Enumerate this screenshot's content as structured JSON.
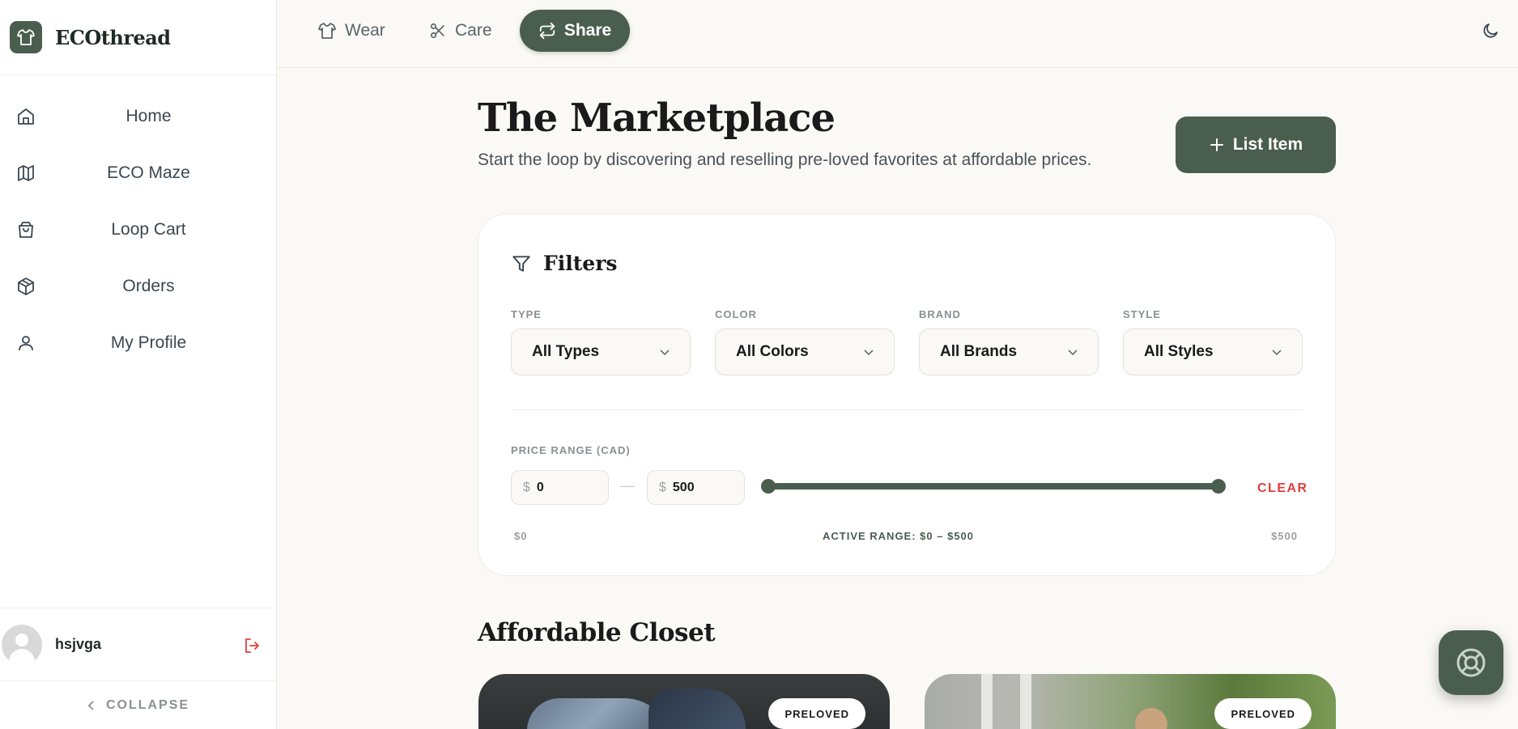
{
  "brand": {
    "name": "ECOthread",
    "logo_icon": "shirt-icon"
  },
  "sidebar": {
    "items": [
      {
        "label": "Home",
        "icon": "home-icon"
      },
      {
        "label": "ECO Maze",
        "icon": "map-icon"
      },
      {
        "label": "Loop Cart",
        "icon": "shopping-bag-icon"
      },
      {
        "label": "Orders",
        "icon": "package-icon"
      },
      {
        "label": "My Profile",
        "icon": "user-icon"
      }
    ],
    "user": {
      "name": "hsjvga"
    },
    "collapse_label": "COLLAPSE"
  },
  "topbar": {
    "tabs": [
      {
        "label": "Wear",
        "icon": "shirt-icon",
        "active": false
      },
      {
        "label": "Care",
        "icon": "scissors-icon",
        "active": false
      },
      {
        "label": "Share",
        "icon": "repeat-icon",
        "active": true
      }
    ],
    "theme_icon": "moon-icon"
  },
  "main": {
    "title": "The Marketplace",
    "subtitle": "Start the loop by discovering and reselling pre-loved favorites at affordable prices.",
    "list_button": "List Item",
    "filters": {
      "heading": "Filters",
      "type": {
        "label": "TYPE",
        "value": "All Types"
      },
      "color": {
        "label": "COLOR",
        "value": "All Colors"
      },
      "brand": {
        "label": "BRAND",
        "value": "All Brands"
      },
      "style": {
        "label": "STYLE",
        "value": "All Styles"
      },
      "price": {
        "label": "PRICE RANGE (CAD)",
        "currency": "$",
        "min_value": "0",
        "max_value": "500",
        "slider_low": 0,
        "slider_high": 500,
        "slider_max": 500,
        "clear_label": "CLEAR",
        "range_min_label": "$0",
        "range_active_label": "ACTIVE RANGE: $0 – $500",
        "range_max_label": "$500"
      }
    },
    "section_title": "Affordable Closet",
    "cards": [
      {
        "badge": "PRELOVED"
      },
      {
        "badge": "PRELOVED"
      }
    ]
  },
  "colors": {
    "primary": "#4a5e4f",
    "danger": "#e23d3d",
    "background": "#faf9f6"
  }
}
